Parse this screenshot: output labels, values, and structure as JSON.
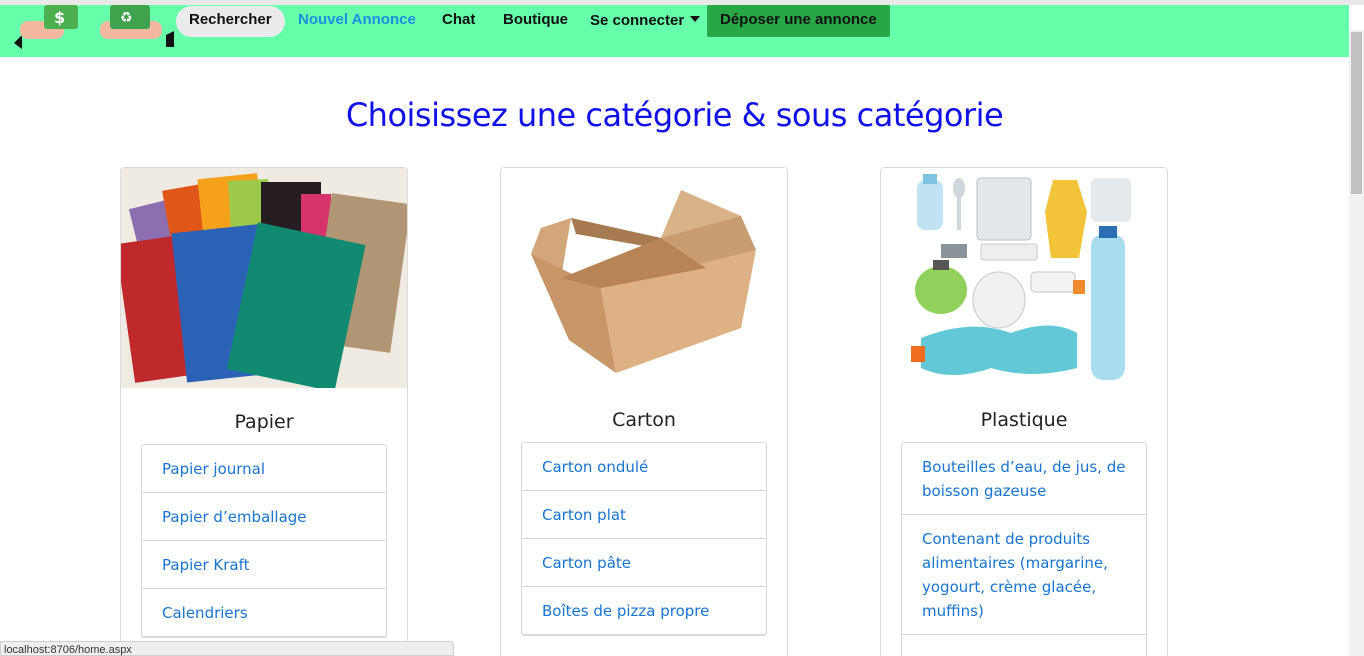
{
  "nav": {
    "search_label": "Rechercher",
    "new_label": "Nouvel Annonce",
    "chat_label": "Chat",
    "shop_label": "Boutique",
    "login_label": "Se connecter",
    "post_label": "Déposer une annonce"
  },
  "heading": "Choisissez une catégorie & sous catégorie",
  "categories": [
    {
      "title": "Papier",
      "items": [
        "Papier journal",
        "Papier d’emballage",
        "Papier Kraft",
        "Calendriers"
      ]
    },
    {
      "title": "Carton",
      "items": [
        "Carton ondulé",
        "Carton plat",
        "Carton pâte",
        "Boîtes de pizza propre"
      ]
    },
    {
      "title": "Plastique",
      "items": [
        "Bouteilles d’eau, de jus, de boisson gazeuse",
        "Contenant de produits alimentaires (margarine, yogourt, crème glacée, muffins)"
      ]
    }
  ],
  "status_url": "localhost:8706/home.aspx",
  "colors": {
    "navbar": "#66ffaa",
    "link": "#1874d2",
    "heading": "#1010e8",
    "post_button": "#28a745"
  }
}
